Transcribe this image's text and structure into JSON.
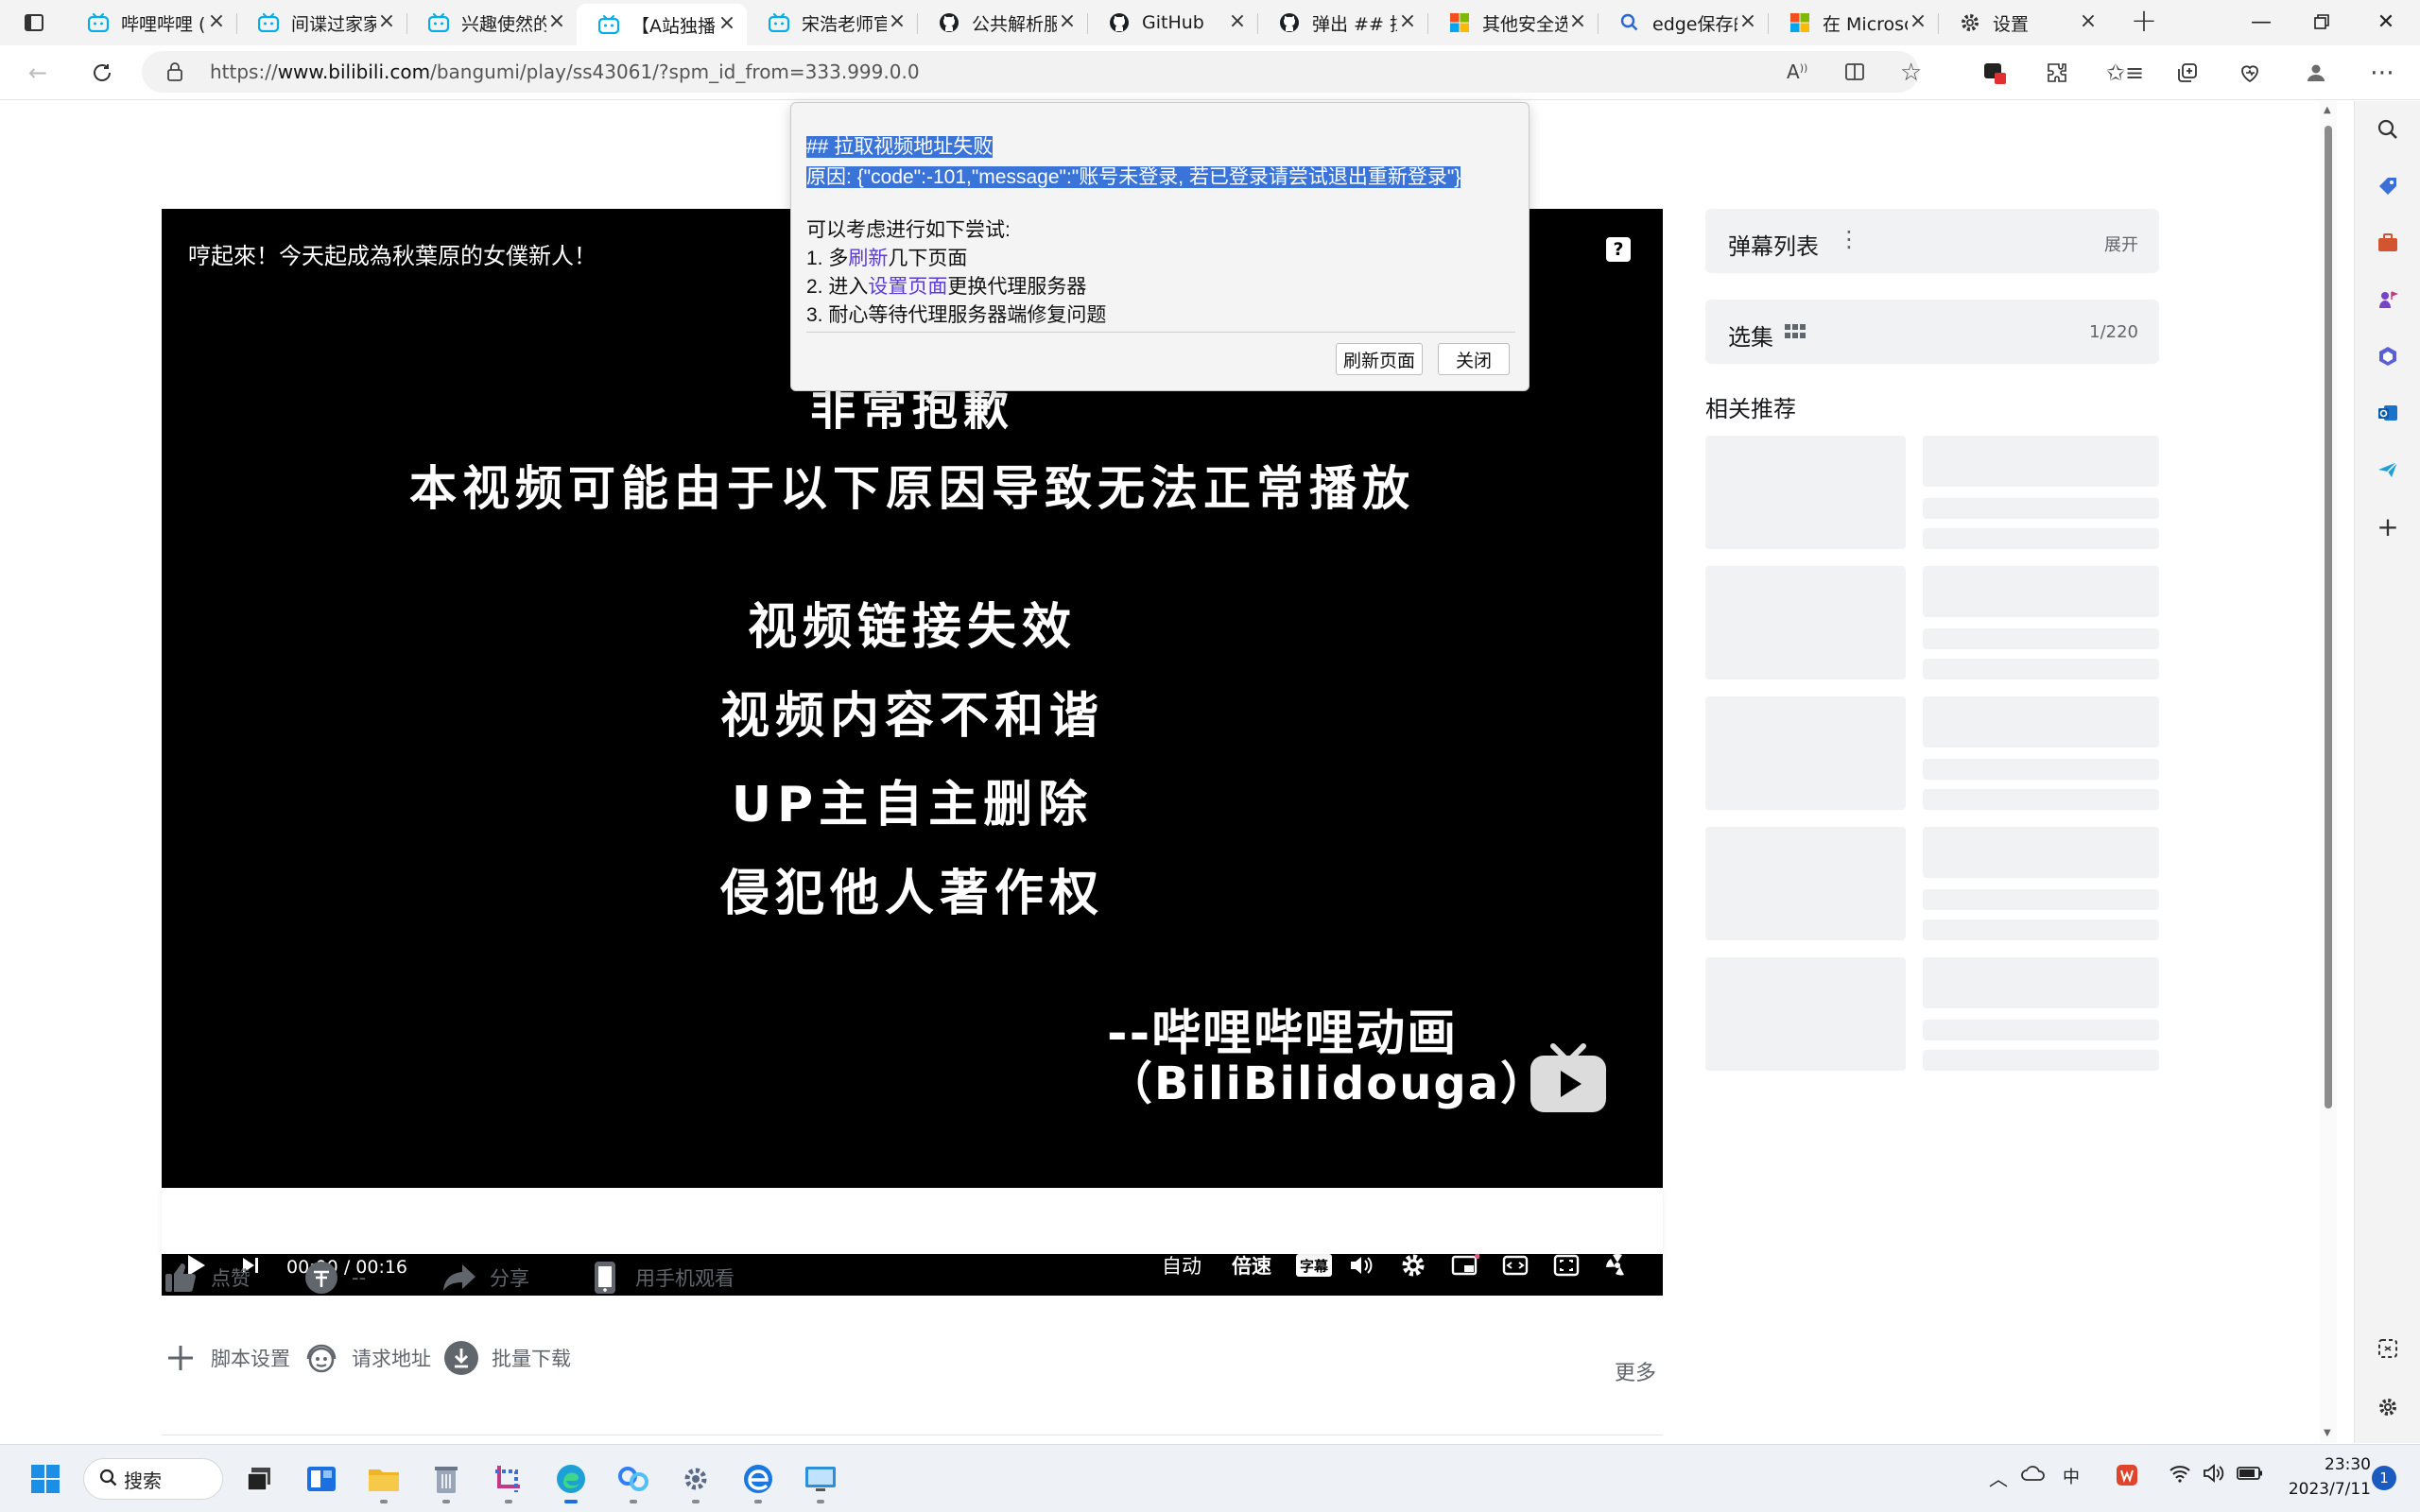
{
  "tabs": [
    {
      "title": "哔哩哔哩 (",
      "icon": "bilibili-icon"
    },
    {
      "title": "间谍过家家",
      "icon": "bilibili-icon"
    },
    {
      "title": "兴趣使然的",
      "icon": "bilibili-icon"
    },
    {
      "title": "【A站独播",
      "icon": "bilibili-icon",
      "active": true
    },
    {
      "title": "宋浩老师官",
      "icon": "bilibili-icon"
    },
    {
      "title": "公共解析服",
      "icon": "github-icon"
    },
    {
      "title": "GitHub",
      "icon": "github-icon"
    },
    {
      "title": "弹出 ## 拉",
      "icon": "github-icon"
    },
    {
      "title": "其他安全选",
      "icon": "microsoft-icon"
    },
    {
      "title": "edge保存的",
      "icon": "search-icon"
    },
    {
      "title": "在 Microso",
      "icon": "microsoft-icon"
    },
    {
      "title": "设置",
      "icon": "gear-icon"
    }
  ],
  "address": {
    "prefix": "https://",
    "domain": "www.bilibili.com",
    "path": "/bangumi/play/ss43061/?spm_id_from=333.999.0.0"
  },
  "player": {
    "title": "哼起來！今天起成為秋葉原的女僕新人！",
    "lines": [
      "非常抱歉",
      "本视频可能由于以下原因导致无法正常播放",
      "视频链接失效",
      "视频内容不和谐",
      "UP主自主删除",
      "侵犯他人著作权"
    ],
    "signature1": "--哔哩哔哩动画",
    "signature2": "（BiliBilidouga）",
    "time_current": "00:00",
    "time_sep": "/",
    "time_total": "00:16",
    "auto_label": "自动",
    "speed_label": "倍速",
    "subtitle_label": "字幕"
  },
  "actions": {
    "like": "点赞",
    "coin": "--",
    "share": "分享",
    "mobile": "用手机观看",
    "script_settings": "脚本设置",
    "request_url": "请求地址",
    "batch_download": "批量下载",
    "more": "更多"
  },
  "sidebar": {
    "danmaku_label": "弹幕列表",
    "expand_label": "展开",
    "episodes_label": "选集",
    "episodes_count": "1/220",
    "related_label": "相关推荐"
  },
  "dialog": {
    "heading": "## 拉取视频地址失败",
    "reason": "原因: {\"code\":-101,\"message\":\"账号未登录, 若已登录请尝试退出重新登录\"}",
    "try_label": "可以考虑进行如下尝试:",
    "step1_a": "1. 多",
    "step1_link": "刷新",
    "step1_b": "几下页面",
    "step2_a": "2. 进入",
    "step2_link": "设置页面",
    "step2_b": "更换代理服务器",
    "step3": "3. 耐心等待代理服务器端修复问题",
    "refresh_button": "刷新页面",
    "close_button": "关闭"
  },
  "taskbar": {
    "search_label": "搜索",
    "time": "23:30",
    "date": "2023/7/11",
    "notification_count": "1"
  },
  "colors": {
    "accent": "#3a74d8",
    "link": "#5b3cd6",
    "bilibili": "#00aeec"
  }
}
